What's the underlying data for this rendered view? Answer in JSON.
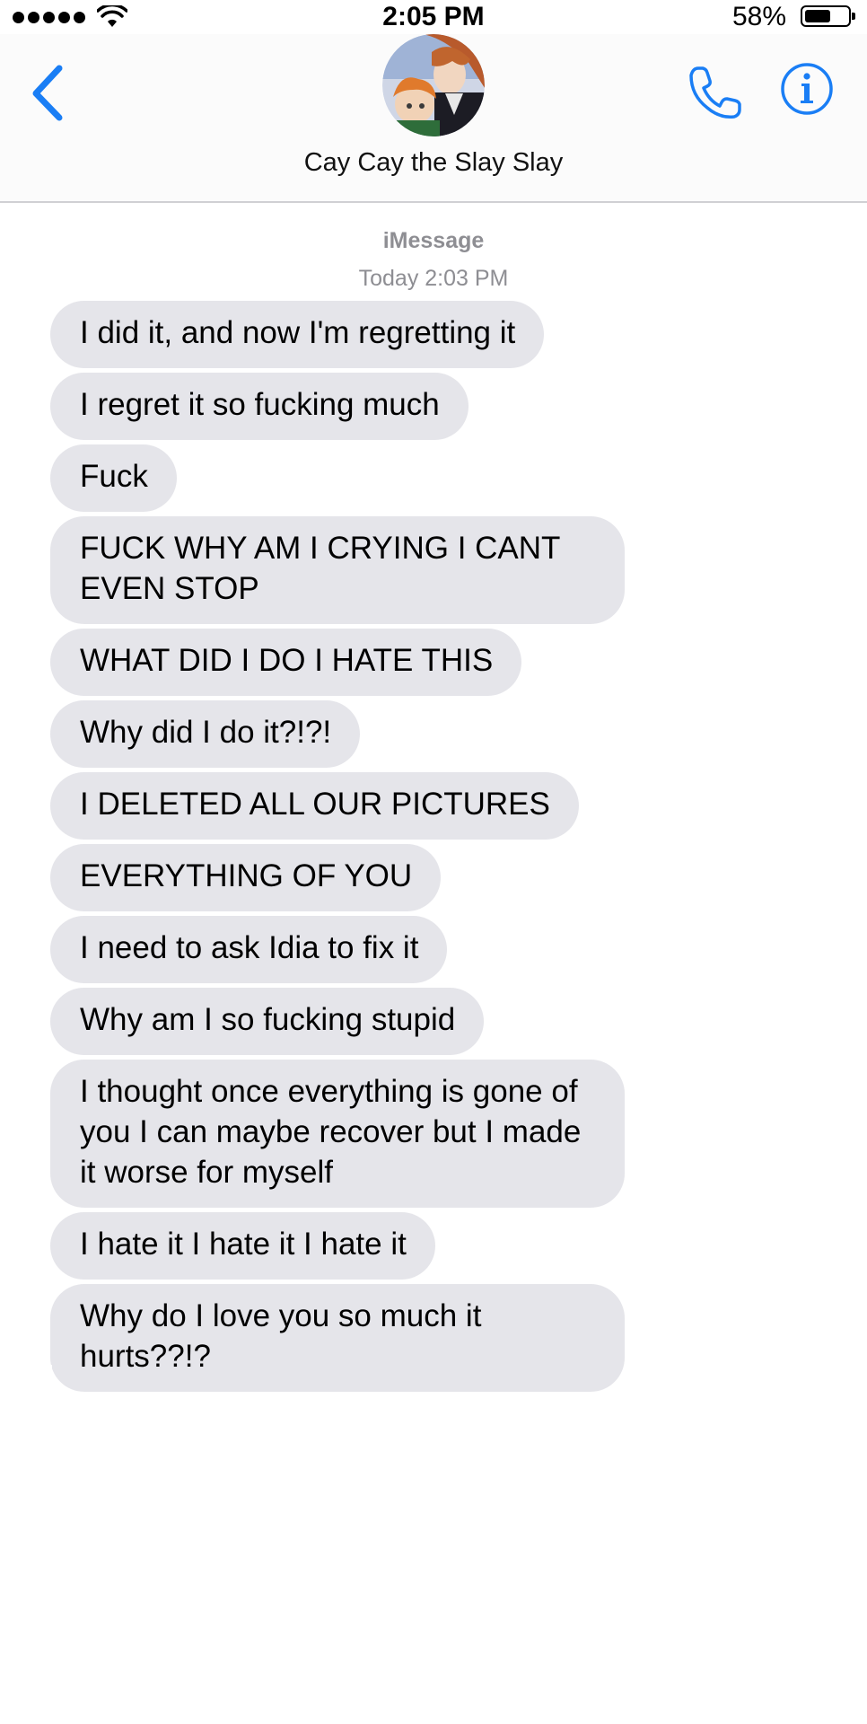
{
  "status_bar": {
    "time": "2:05 PM",
    "battery_percent": "58%",
    "battery_level": 0.58,
    "signal_bars": 5
  },
  "header": {
    "contact_name": "Cay Cay the Slay Slay",
    "back_icon": "chevron-left-icon",
    "call_icon": "phone-icon",
    "info_icon": "info-icon"
  },
  "conversation": {
    "service": "iMessage",
    "timestamp": "Today 2:03 PM",
    "messages": [
      {
        "text": "I did it, and now I'm regretting it"
      },
      {
        "text": "I regret it so fucking much"
      },
      {
        "text": "Fuck"
      },
      {
        "text": "FUCK WHY AM I CRYING I CANT EVEN STOP"
      },
      {
        "text": "WHAT DID I DO I HATE THIS"
      },
      {
        "text": "Why did I do it?!?!"
      },
      {
        "text": "I DELETED ALL OUR PICTURES"
      },
      {
        "text": "EVERYTHING OF YOU"
      },
      {
        "text": "I need to ask Idia to fix it"
      },
      {
        "text": "Why am I so fucking stupid"
      },
      {
        "text": "I thought once everything is gone of you I can maybe recover but I made it worse for myself"
      },
      {
        "text": "I hate it I hate it I hate it"
      },
      {
        "text": "Why do I love you so much it hurts??!?"
      }
    ]
  },
  "colors": {
    "accent": "#1a7ef5",
    "bubble_received": "#e5e5ea",
    "secondary_text": "#8e8e93"
  }
}
